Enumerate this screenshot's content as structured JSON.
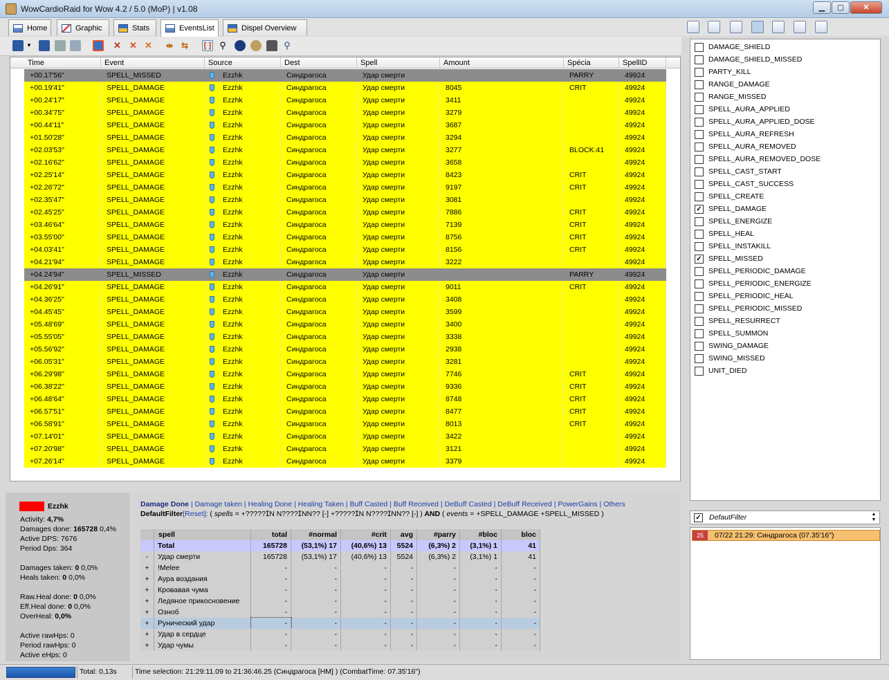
{
  "window": {
    "title": "WowCardioRaid for Wow 4.2 / 5.0 (MoP) | v1.08"
  },
  "tabs": [
    {
      "label": "Home"
    },
    {
      "label": "Graphic"
    },
    {
      "label": "Stats"
    },
    {
      "label": "EventsList",
      "active": true
    },
    {
      "label": "Dispel Overview"
    }
  ],
  "grid": {
    "columns": [
      "Time",
      "Event",
      "Source",
      "Dest",
      "Spell",
      "Amount",
      "Spécia",
      "SpellID"
    ],
    "rows": [
      {
        "time": "+00.17'56\"",
        "event": "SPELL_MISSED",
        "source": "Ezzhk",
        "dest": "Синдрагоса",
        "spell": "Удар смерти",
        "amount": "",
        "special": "PARRY",
        "id": "49924",
        "color": "gray"
      },
      {
        "time": "+00.19'41\"",
        "event": "SPELL_DAMAGE",
        "source": "Ezzhk",
        "dest": "Синдрагоса",
        "spell": "Удар смерти",
        "amount": "8045",
        "special": "CRIT",
        "id": "49924",
        "color": "yellow"
      },
      {
        "time": "+00.24'17\"",
        "event": "SPELL_DAMAGE",
        "source": "Ezzhk",
        "dest": "Синдрагоса",
        "spell": "Удар смерти",
        "amount": "3411",
        "special": "",
        "id": "49924",
        "color": "yellow"
      },
      {
        "time": "+00.34'75\"",
        "event": "SPELL_DAMAGE",
        "source": "Ezzhk",
        "dest": "Синдрагоса",
        "spell": "Удар смерти",
        "amount": "3279",
        "special": "",
        "id": "49924",
        "color": "yellow"
      },
      {
        "time": "+00.44'11\"",
        "event": "SPELL_DAMAGE",
        "source": "Ezzhk",
        "dest": "Синдрагоса",
        "spell": "Удар смерти",
        "amount": "3687",
        "special": "",
        "id": "49924",
        "color": "yellow"
      },
      {
        "time": "+01.50'28\"",
        "event": "SPELL_DAMAGE",
        "source": "Ezzhk",
        "dest": "Синдрагоса",
        "spell": "Удар смерти",
        "amount": "3294",
        "special": "",
        "id": "49924",
        "color": "yellow"
      },
      {
        "time": "+02.03'53\"",
        "event": "SPELL_DAMAGE",
        "source": "Ezzhk",
        "dest": "Синдрагоса",
        "spell": "Удар смерти",
        "amount": "3277",
        "special": "BLOCK:41",
        "id": "49924",
        "color": "yellow"
      },
      {
        "time": "+02.16'62\"",
        "event": "SPELL_DAMAGE",
        "source": "Ezzhk",
        "dest": "Синдрагоса",
        "spell": "Удар смерти",
        "amount": "3658",
        "special": "",
        "id": "49924",
        "color": "yellow"
      },
      {
        "time": "+02.25'14\"",
        "event": "SPELL_DAMAGE",
        "source": "Ezzhk",
        "dest": "Синдрагоса",
        "spell": "Удар смерти",
        "amount": "8423",
        "special": "CRIT",
        "id": "49924",
        "color": "yellow"
      },
      {
        "time": "+02.26'72\"",
        "event": "SPELL_DAMAGE",
        "source": "Ezzhk",
        "dest": "Синдрагоса",
        "spell": "Удар смерти",
        "amount": "9197",
        "special": "CRIT",
        "id": "49924",
        "color": "yellow"
      },
      {
        "time": "+02.35'47\"",
        "event": "SPELL_DAMAGE",
        "source": "Ezzhk",
        "dest": "Синдрагоса",
        "spell": "Удар смерти",
        "amount": "3081",
        "special": "",
        "id": "49924",
        "color": "yellow"
      },
      {
        "time": "+02.45'25\"",
        "event": "SPELL_DAMAGE",
        "source": "Ezzhk",
        "dest": "Синдрагоса",
        "spell": "Удар смерти",
        "amount": "7886",
        "special": "CRIT",
        "id": "49924",
        "color": "yellow"
      },
      {
        "time": "+03.46'64\"",
        "event": "SPELL_DAMAGE",
        "source": "Ezzhk",
        "dest": "Синдрагоса",
        "spell": "Удар смерти",
        "amount": "7139",
        "special": "CRIT",
        "id": "49924",
        "color": "yellow"
      },
      {
        "time": "+03.55'00\"",
        "event": "SPELL_DAMAGE",
        "source": "Ezzhk",
        "dest": "Синдрагоса",
        "spell": "Удар смерти",
        "amount": "8756",
        "special": "CRIT",
        "id": "49924",
        "color": "yellow"
      },
      {
        "time": "+04.03'41\"",
        "event": "SPELL_DAMAGE",
        "source": "Ezzhk",
        "dest": "Синдрагоса",
        "spell": "Удар смерти",
        "amount": "8156",
        "special": "CRIT",
        "id": "49924",
        "color": "yellow"
      },
      {
        "time": "+04.21'94\"",
        "event": "SPELL_DAMAGE",
        "source": "Ezzhk",
        "dest": "Синдрагоса",
        "spell": "Удар смерти",
        "amount": "3222",
        "special": "",
        "id": "49924",
        "color": "yellow"
      },
      {
        "time": "+04.24'94\"",
        "event": "SPELL_MISSED",
        "source": "Ezzhk",
        "dest": "Синдрагоса",
        "spell": "Удар смерти",
        "amount": "",
        "special": "PARRY",
        "id": "49924",
        "color": "gray"
      },
      {
        "time": "+04.26'91\"",
        "event": "SPELL_DAMAGE",
        "source": "Ezzhk",
        "dest": "Синдрагоса",
        "spell": "Удар смерти",
        "amount": "9011",
        "special": "CRIT",
        "id": "49924",
        "color": "yellow"
      },
      {
        "time": "+04.36'25\"",
        "event": "SPELL_DAMAGE",
        "source": "Ezzhk",
        "dest": "Синдрагоса",
        "spell": "Удар смерти",
        "amount": "3408",
        "special": "",
        "id": "49924",
        "color": "yellow"
      },
      {
        "time": "+04.45'45\"",
        "event": "SPELL_DAMAGE",
        "source": "Ezzhk",
        "dest": "Синдрагоса",
        "spell": "Удар смерти",
        "amount": "3599",
        "special": "",
        "id": "49924",
        "color": "yellow"
      },
      {
        "time": "+05.48'69\"",
        "event": "SPELL_DAMAGE",
        "source": "Ezzhk",
        "dest": "Синдрагоса",
        "spell": "Удар смерти",
        "amount": "3400",
        "special": "",
        "id": "49924",
        "color": "yellow"
      },
      {
        "time": "+05.55'05\"",
        "event": "SPELL_DAMAGE",
        "source": "Ezzhk",
        "dest": "Синдрагоса",
        "spell": "Удар смерти",
        "amount": "3338",
        "special": "",
        "id": "49924",
        "color": "yellow"
      },
      {
        "time": "+05.56'92\"",
        "event": "SPELL_DAMAGE",
        "source": "Ezzhk",
        "dest": "Синдрагоса",
        "spell": "Удар смерти",
        "amount": "2938",
        "special": "",
        "id": "49924",
        "color": "yellow"
      },
      {
        "time": "+06.05'31\"",
        "event": "SPELL_DAMAGE",
        "source": "Ezzhk",
        "dest": "Синдрагоса",
        "spell": "Удар смерти",
        "amount": "3281",
        "special": "",
        "id": "49924",
        "color": "yellow"
      },
      {
        "time": "+06.29'98\"",
        "event": "SPELL_DAMAGE",
        "source": "Ezzhk",
        "dest": "Синдрагоса",
        "spell": "Удар смерти",
        "amount": "7746",
        "special": "CRIT",
        "id": "49924",
        "color": "yellow"
      },
      {
        "time": "+06.38'22\"",
        "event": "SPELL_DAMAGE",
        "source": "Ezzhk",
        "dest": "Синдрагоса",
        "spell": "Удар смерти",
        "amount": "9336",
        "special": "CRIT",
        "id": "49924",
        "color": "yellow"
      },
      {
        "time": "+06.48'64\"",
        "event": "SPELL_DAMAGE",
        "source": "Ezzhk",
        "dest": "Синдрагоса",
        "spell": "Удар смерти",
        "amount": "8748",
        "special": "CRIT",
        "id": "49924",
        "color": "yellow"
      },
      {
        "time": "+06.57'51\"",
        "event": "SPELL_DAMAGE",
        "source": "Ezzhk",
        "dest": "Синдрагоса",
        "spell": "Удар смерти",
        "amount": "8477",
        "special": "CRIT",
        "id": "49924",
        "color": "yellow"
      },
      {
        "time": "+06.58'91\"",
        "event": "SPELL_DAMAGE",
        "source": "Ezzhk",
        "dest": "Синдрагоса",
        "spell": "Удар смерти",
        "amount": "8013",
        "special": "CRIT",
        "id": "49924",
        "color": "yellow"
      },
      {
        "time": "+07.14'01\"",
        "event": "SPELL_DAMAGE",
        "source": "Ezzhk",
        "dest": "Синдрагоса",
        "spell": "Удар смерти",
        "amount": "3422",
        "special": "",
        "id": "49924",
        "color": "yellow"
      },
      {
        "time": "+07.20'98\"",
        "event": "SPELL_DAMAGE",
        "source": "Ezzhk",
        "dest": "Синдрагоса",
        "spell": "Удар смерти",
        "amount": "3121",
        "special": "",
        "id": "49924",
        "color": "yellow"
      },
      {
        "time": "+07.26'14\"",
        "event": "SPELL_DAMAGE",
        "source": "Ezzhk",
        "dest": "Синдрагоса",
        "spell": "Удар смерти",
        "amount": "3379",
        "special": "",
        "id": "49924",
        "color": "yellow"
      }
    ]
  },
  "event_filters": [
    {
      "label": "DAMAGE_SHIELD",
      "checked": false
    },
    {
      "label": "DAMAGE_SHIELD_MISSED",
      "checked": false
    },
    {
      "label": "PARTY_KILL",
      "checked": false
    },
    {
      "label": "RANGE_DAMAGE",
      "checked": false
    },
    {
      "label": "RANGE_MISSED",
      "checked": false
    },
    {
      "label": "SPELL_AURA_APPLIED",
      "checked": false
    },
    {
      "label": "SPELL_AURA_APPLIED_DOSE",
      "checked": false
    },
    {
      "label": "SPELL_AURA_REFRESH",
      "checked": false
    },
    {
      "label": "SPELL_AURA_REMOVED",
      "checked": false
    },
    {
      "label": "SPELL_AURA_REMOVED_DOSE",
      "checked": false
    },
    {
      "label": "SPELL_CAST_START",
      "checked": false
    },
    {
      "label": "SPELL_CAST_SUCCESS",
      "checked": false
    },
    {
      "label": "SPELL_CREATE",
      "checked": false
    },
    {
      "label": "SPELL_DAMAGE",
      "checked": true
    },
    {
      "label": "SPELL_ENERGIZE",
      "checked": false
    },
    {
      "label": "SPELL_HEAL",
      "checked": false
    },
    {
      "label": "SPELL_INSTAKILL",
      "checked": false
    },
    {
      "label": "SPELL_MISSED",
      "checked": true
    },
    {
      "label": "SPELL_PERIODIC_DAMAGE",
      "checked": false
    },
    {
      "label": "SPELL_PERIODIC_ENERGIZE",
      "checked": false
    },
    {
      "label": "SPELL_PERIODIC_HEAL",
      "checked": false
    },
    {
      "label": "SPELL_PERIODIC_MISSED",
      "checked": false
    },
    {
      "label": "SPELL_RESURRECT",
      "checked": false
    },
    {
      "label": "SPELL_SUMMON",
      "checked": false
    },
    {
      "label": "SWING_DAMAGE",
      "checked": false
    },
    {
      "label": "SWING_MISSED",
      "checked": false
    },
    {
      "label": "UNIT_DIED",
      "checked": false
    }
  ],
  "filter_bar": {
    "name": "DefautFilter",
    "checked": true
  },
  "fight": {
    "number": "25",
    "text": "07/22  21:29: Синдрагоса (07.35'16\")"
  },
  "player": {
    "name": "Ezzhk",
    "color": "#ff0000",
    "activity_label": "Activity:",
    "activity": "4,7%",
    "damages_label": "Damages done:",
    "damages": "165728",
    "damages_pct": "0,4%",
    "active_dps": "Active DPS: 7676",
    "period_dps": "Period Dps: 364",
    "dmg_taken_label": "Damages taken:",
    "dmg_taken": "0",
    "dmg_taken_pct": "0,0%",
    "heals_taken_label": "Heals taken:",
    "heals_taken": "0",
    "heals_taken_pct": "0,0%",
    "raw_heal_label": "Raw.Heal done:",
    "raw_heal": "0",
    "raw_heal_pct": "0,0%",
    "eff_heal_label": "Eff.Heal done:",
    "eff_heal": "0",
    "eff_heal_pct": "0,0%",
    "overheal_label": "OverHeal:",
    "overheal": "0,0%",
    "active_rawhps": "Active rawHps: 0",
    "period_rawhps": "Period rawHps: 0",
    "active_ehps": "Active eHps: 0"
  },
  "stat_links": [
    "Damage Done",
    "Damage taken",
    "Healing Done",
    "Healing Taken",
    "Buff Casted",
    "Buff Received",
    "DeBuff Casted",
    "DeBuff Received",
    "PowerGains",
    "Others"
  ],
  "filter_desc": {
    "name": "DefaultFilter",
    "reset": "[Reset]",
    "colon": ":",
    "text1": "( ",
    "spells_kw": "spells",
    "text2": " = +?????ⵊN⵱ N????ⵊN⵱N⵱?? [-] +?????ⵊN⵱ N????ⵊN⵱N⵱?? [-] )",
    "and": " AND ",
    "text3": "( ",
    "events_kw": "events",
    "text4": " = +SPELL_DAMAGE +SPELL_MISSED )"
  },
  "stats_table": {
    "headers": [
      "spell",
      "total",
      "#normal",
      "#crit",
      "avg",
      "#parry",
      "#bloc",
      "bloc"
    ],
    "rows": [
      {
        "exp": "",
        "spell": "Total",
        "total": "165728",
        "normal_pct": "(53,1%)",
        "normal": "17",
        "crit_pct": "(40,6%)",
        "crit": "13",
        "avg": "5524",
        "parry_pct": "(6,3%)",
        "parry": "2",
        "bloc_pct": "(3,1%)",
        "bloc_n": "1",
        "bloc": "41",
        "style": "total"
      },
      {
        "exp": "-",
        "spell": "Удар смерти",
        "total": "165728",
        "normal_pct": "(53,1%)",
        "normal": "17",
        "crit_pct": "(40,6%)",
        "crit": "13",
        "avg": "5524",
        "parry_pct": "(6,3%)",
        "parry": "2",
        "bloc_pct": "(3,1%)",
        "bloc_n": "1",
        "bloc": "41",
        "style": "normal"
      },
      {
        "exp": "+",
        "spell": "!Melee",
        "total": "-",
        "normal_pct": "",
        "normal": "-",
        "crit_pct": "",
        "crit": "-",
        "avg": "-",
        "parry_pct": "",
        "parry": "-",
        "bloc_pct": "",
        "bloc_n": "-",
        "bloc": "-",
        "style": "normal"
      },
      {
        "exp": "+",
        "spell": "Аура воздания",
        "total": "-",
        "normal_pct": "",
        "normal": "-",
        "crit_pct": "",
        "crit": "-",
        "avg": "-",
        "parry_pct": "",
        "parry": "-",
        "bloc_pct": "",
        "bloc_n": "-",
        "bloc": "-",
        "style": "normal"
      },
      {
        "exp": "+",
        "spell": "Кровавая чума",
        "total": "-",
        "normal_pct": "",
        "normal": "-",
        "crit_pct": "",
        "crit": "-",
        "avg": "-",
        "parry_pct": "",
        "parry": "-",
        "bloc_pct": "",
        "bloc_n": "-",
        "bloc": "-",
        "style": "normal"
      },
      {
        "exp": "+",
        "spell": "Ледяное прикосновение",
        "total": "-",
        "normal_pct": "",
        "normal": "-",
        "crit_pct": "",
        "crit": "-",
        "avg": "-",
        "parry_pct": "",
        "parry": "-",
        "bloc_pct": "",
        "bloc_n": "-",
        "bloc": "-",
        "style": "normal"
      },
      {
        "exp": "+",
        "spell": "Озноб",
        "total": "-",
        "normal_pct": "",
        "normal": "-",
        "crit_pct": "",
        "crit": "-",
        "avg": "-",
        "parry_pct": "",
        "parry": "-",
        "bloc_pct": "",
        "bloc_n": "-",
        "bloc": "-",
        "style": "normal"
      },
      {
        "exp": "+",
        "spell": "Рунический удар",
        "total": "-",
        "normal_pct": "",
        "normal": "-",
        "crit_pct": "",
        "crit": "-",
        "avg": "-",
        "parry_pct": "",
        "parry": "-",
        "bloc_pct": "",
        "bloc_n": "-",
        "bloc": "-",
        "style": "selected"
      },
      {
        "exp": "+",
        "spell": "Удар в сердце",
        "total": "-",
        "normal_pct": "",
        "normal": "-",
        "crit_pct": "",
        "crit": "-",
        "avg": "-",
        "parry_pct": "",
        "parry": "-",
        "bloc_pct": "",
        "bloc_n": "-",
        "bloc": "-",
        "style": "normal"
      },
      {
        "exp": "+",
        "spell": "Удар чумы",
        "total": "-",
        "normal_pct": "",
        "normal": "-",
        "crit_pct": "",
        "crit": "-",
        "avg": "-",
        "parry_pct": "",
        "parry": "-",
        "bloc_pct": "",
        "bloc_n": "-",
        "bloc": "-",
        "style": "normal"
      }
    ]
  },
  "status": {
    "total": "Total: 0,13s",
    "selection": "Time selection: 21:29:11.09 to 21:36:46.25 (Синдрагоса [HM] )  (CombatTime: 07.35'16\")"
  },
  "colors": {
    "row_yellow": "#ffff00",
    "row_gray": "#8c8c8c",
    "total_row": "#c8c8ff",
    "selected_row": "#b8cce0",
    "link": "#1a3ea8"
  }
}
